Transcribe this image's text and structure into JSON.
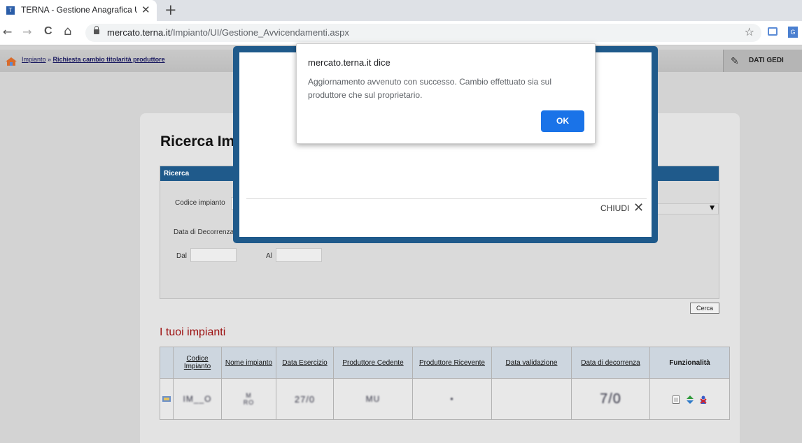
{
  "browser": {
    "tab_title": "TERNA - Gestione Anagrafica Un",
    "tab_close": "✕",
    "new_tab": "+",
    "url_domain": "mercato.terna.it",
    "url_path": "/Impianto/UI/Gestione_Avvicendamenti.aspx",
    "nav_back": "←",
    "nav_forward": "→",
    "nav_reload": "C",
    "nav_home": "⌂",
    "star": "☆"
  },
  "header": {
    "breadcrumb_link": "Impianto",
    "breadcrumb_sep": " » ",
    "breadcrumb_current": "Richiesta cambio titolarità produttore",
    "gedi_label": "DATI GEDI"
  },
  "search": {
    "page_title": "Ricerca Im",
    "section_title": "Ricerca",
    "codice_label": "Codice impianto",
    "data_decorrenza_label": "Data di Decorrenza",
    "dal_label": "Dal",
    "al_label": "Al",
    "cerca_label": "Cerca"
  },
  "impianti": {
    "title": "I tuoi impianti",
    "columns": [
      "Codice Impianto",
      "Nome impianto",
      "Data Esercizio",
      "Produttore Cedente",
      "Produttore Ricevente",
      "Data validazione",
      "Data di decorrenza",
      "Funzionalità"
    ],
    "row": {
      "codice": "IM__O",
      "nome": "M\nRO",
      "data_esercizio": "27/0",
      "produttore_cedente": "MU",
      "produttore_ricevente": "•",
      "data_validazione": "",
      "data_decorrenza": "7/0"
    }
  },
  "modal": {
    "close_label": "CHIUDI",
    "close_icon": "✕"
  },
  "alert": {
    "title": "mercato.terna.it dice",
    "message": "Aggiornamento avvenuto con successo. Cambio effettuato sia sul produttore che sul proprietario.",
    "ok_label": "OK"
  },
  "colors": {
    "modal_frame": "#1f5a8b",
    "ok_button": "#1a73e8",
    "impianti_title": "#9c1010"
  }
}
